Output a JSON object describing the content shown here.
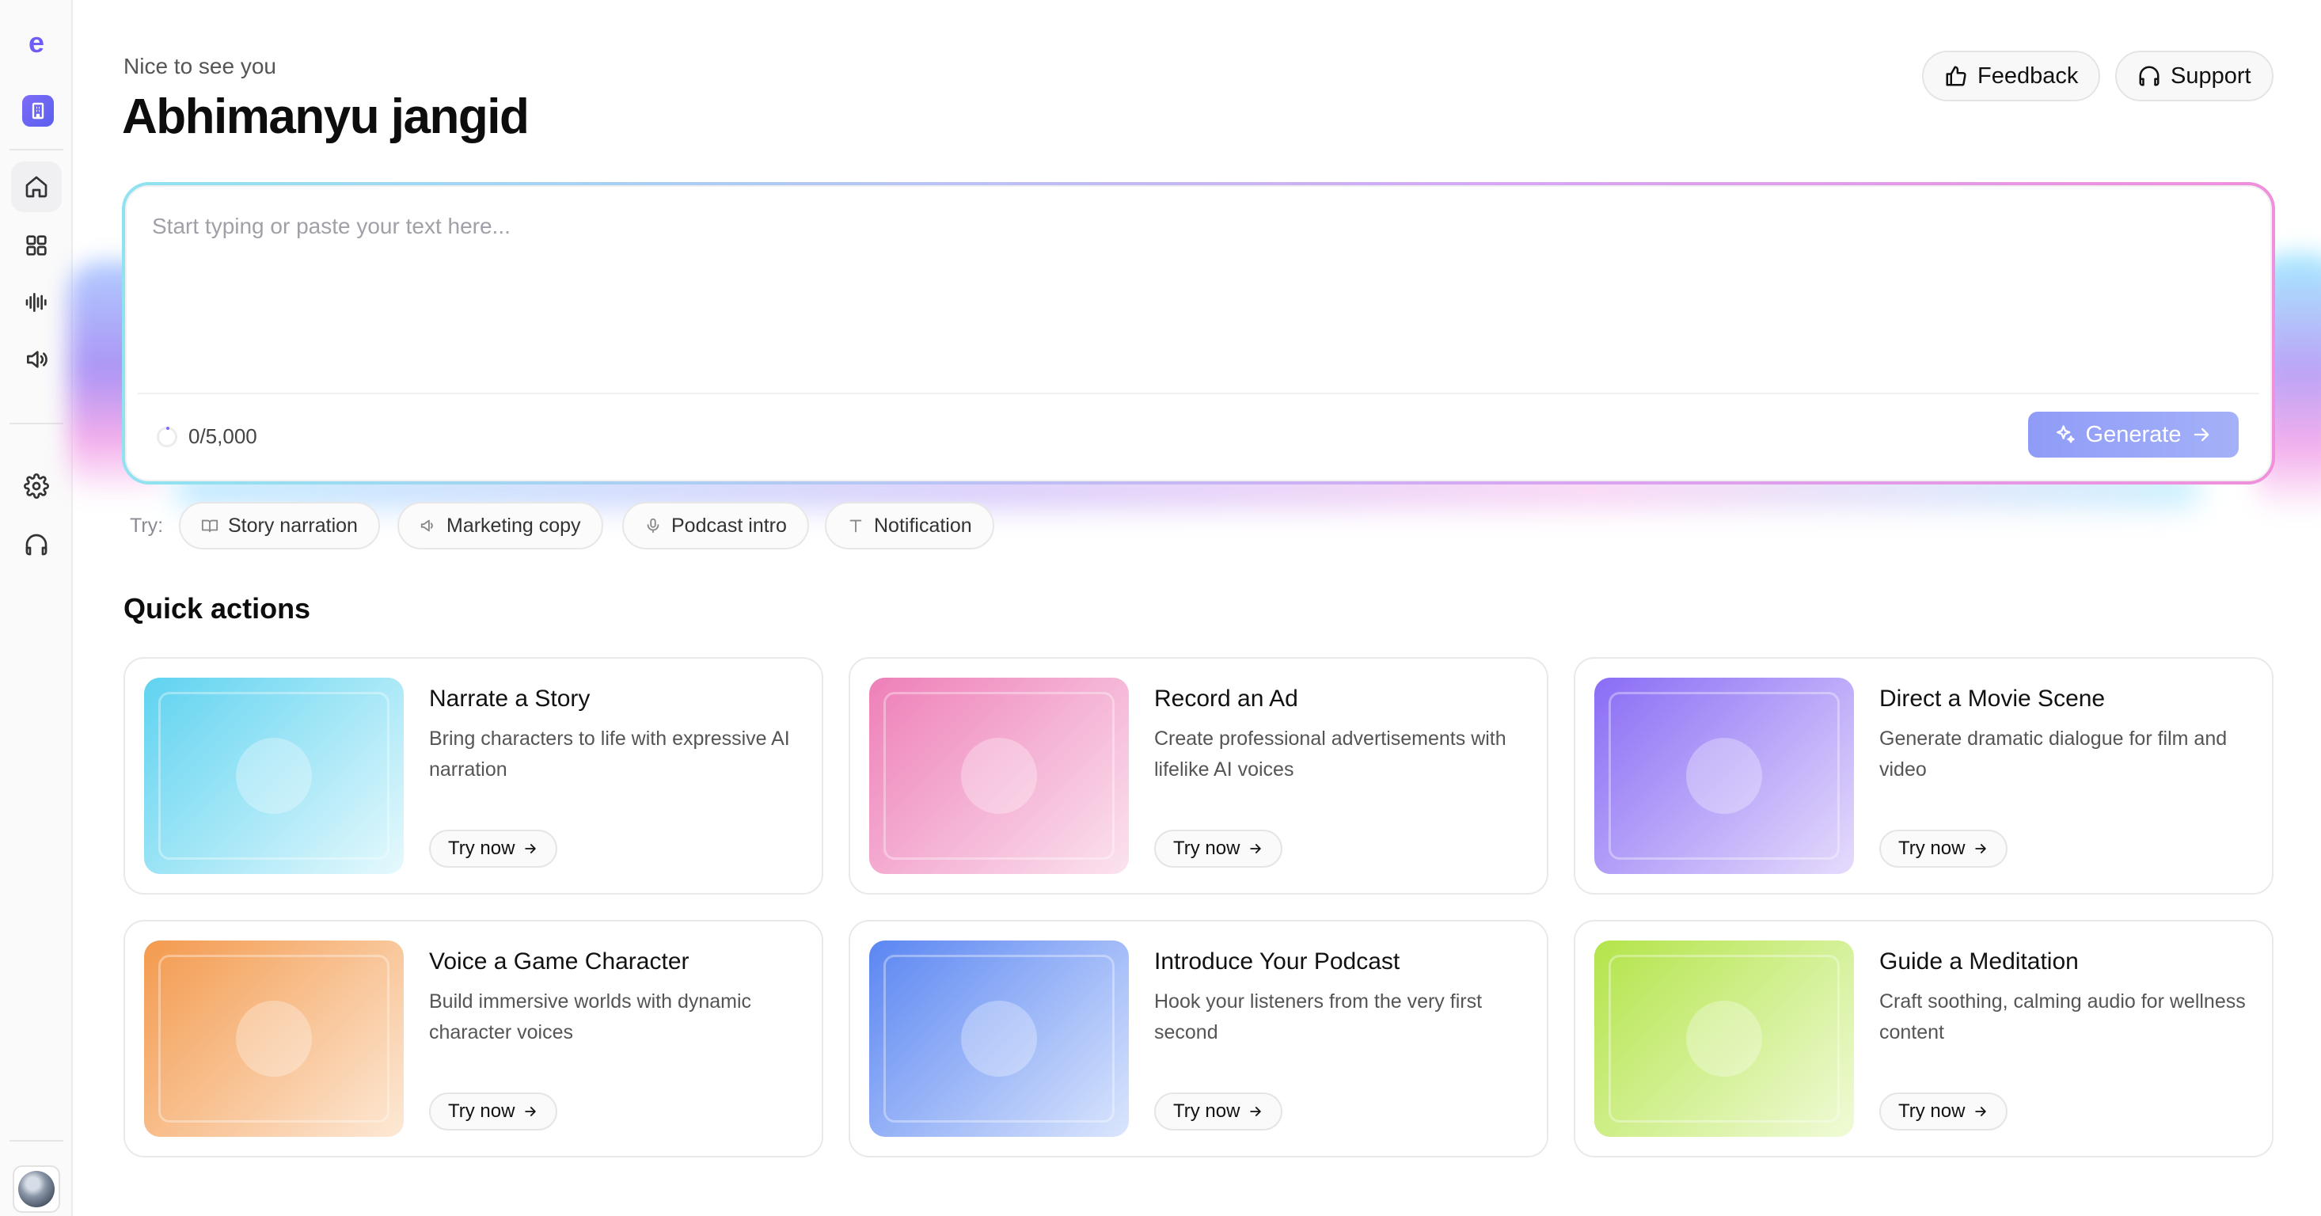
{
  "sidebar": {
    "logo": "e",
    "workspace_icon": "building-icon",
    "nav": [
      {
        "name": "home-icon"
      },
      {
        "name": "grid-icon"
      },
      {
        "name": "waveform-icon"
      },
      {
        "name": "speaker-icon"
      }
    ],
    "bottom": [
      {
        "name": "gear-icon"
      },
      {
        "name": "headphones-icon"
      }
    ]
  },
  "header": {
    "greeting": "Nice to see you",
    "username": "Abhimanyu jangid",
    "feedback_label": "Feedback",
    "support_label": "Support"
  },
  "editor": {
    "placeholder": "Start typing or paste your text here...",
    "counter": "0/5,000",
    "generate_label": "Generate"
  },
  "suggestions": {
    "label": "Try:",
    "chips": [
      "Story narration",
      "Marketing copy",
      "Podcast intro",
      "Notification"
    ]
  },
  "quick_actions": {
    "title": "Quick actions",
    "try_label": "Try now",
    "cards": [
      {
        "title": "Narrate a Story",
        "description": "Bring characters to life with expressive AI narration",
        "gradient": [
          "#5fd3f0",
          "#e6f9fd"
        ]
      },
      {
        "title": "Record an Ad",
        "description": "Create professional advertisements with lifelike AI voices",
        "gradient": [
          "#ee7fb8",
          "#fbe3ef"
        ]
      },
      {
        "title": "Direct a Movie Scene",
        "description": "Generate dramatic dialogue for film and video",
        "gradient": [
          "#8a6cf5",
          "#e6dcfc"
        ]
      },
      {
        "title": "Voice a Game Character",
        "description": "Build immersive worlds with dynamic character voices",
        "gradient": [
          "#f39a4e",
          "#fde9d6"
        ]
      },
      {
        "title": "Introduce Your Podcast",
        "description": "Hook your listeners from the very first second",
        "gradient": [
          "#5b86f2",
          "#dbe6fd"
        ]
      },
      {
        "title": "Guide a Meditation",
        "description": "Craft soothing, calming audio for wellness content",
        "gradient": [
          "#b3e449",
          "#f0fbd8"
        ]
      }
    ]
  },
  "colors": {
    "accent": "#6d5cf5",
    "generate": "#94a1f7"
  }
}
